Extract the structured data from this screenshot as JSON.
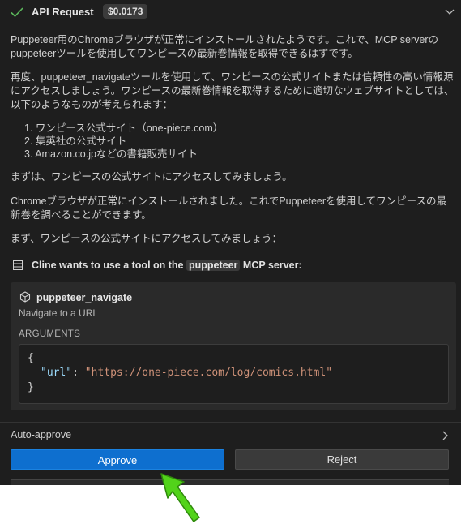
{
  "header": {
    "title": "API Request",
    "cost": "$0.0173"
  },
  "messages": {
    "p1": "Puppeteer用のChromeブラウザが正常にインストールされたようです。これで、MCP serverのpuppeteerツールを使用してワンピースの最新巻情報を取得できるはずです。",
    "p2": "再度、puppeteer_navigateツールを使用して、ワンピースの公式サイトまたは信頼性の高い情報源にアクセスしましょう。ワンピースの最新巻情報を取得するために適切なウェブサイトとしては、以下のようなものが考えられます：",
    "list": [
      "1. ワンピース公式サイト（one-piece.com）",
      "2. 集英社の公式サイト",
      "3. Amazon.co.jpなどの書籍販売サイト"
    ],
    "p3": "まずは、ワンピースの公式サイトにアクセスしてみましょう。",
    "p4": "Chromeブラウザが正常にインストールされました。これでPuppeteerを使用してワンピースの最新巻を調べることができます。",
    "p5": "まず、ワンピースの公式サイトにアクセスしてみましょう："
  },
  "tool_request": {
    "prefix": "Cline wants to use a tool on the",
    "server": "puppeteer",
    "suffix": "MCP server:",
    "tool_name": "puppeteer_navigate",
    "tool_description": "Navigate to a URL",
    "arguments_label": "ARGUMENTS",
    "code": {
      "open": "{",
      "key": "\"url\"",
      "colon": ": ",
      "value": "\"https://one-piece.com/log/comics.html\"",
      "close": "}"
    }
  },
  "footer": {
    "auto_approve": "Auto-approve",
    "approve_label": "Approve",
    "reject_label": "Reject"
  },
  "colors": {
    "accent": "#0e6fcf",
    "success": "#5cb85c",
    "cursor": "#52d31a"
  }
}
